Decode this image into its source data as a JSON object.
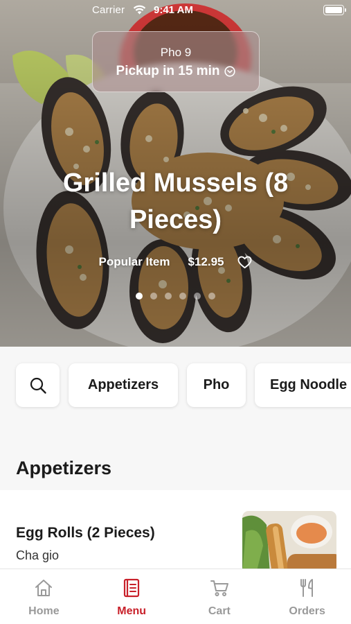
{
  "status_bar": {
    "carrier": "Carrier",
    "time": "9:41 AM"
  },
  "pickup": {
    "store": "Pho 9",
    "mode": "Pickup in 15 min",
    "icon": "chevron-down-circle-icon"
  },
  "hero": {
    "title": "Grilled Mussels (8 Pieces)",
    "tag": "Popular Item",
    "price": "$12.95",
    "favorite_icon": "heart-icon",
    "carousel": {
      "count": 6,
      "active_index": 0
    }
  },
  "categories": {
    "search_icon": "search-icon",
    "items": [
      "Appetizers",
      "Pho",
      "Egg Noodle Soup"
    ]
  },
  "section": {
    "title": "Appetizers"
  },
  "menu_items": [
    {
      "name": "Egg Rolls (2 Pieces)",
      "description": "Cha gio"
    }
  ],
  "tabs": [
    {
      "label": "Home",
      "icon": "home-icon",
      "active": false
    },
    {
      "label": "Menu",
      "icon": "menu-book-icon",
      "active": true
    },
    {
      "label": "Cart",
      "icon": "cart-icon",
      "active": false
    },
    {
      "label": "Orders",
      "icon": "fork-knife-icon",
      "active": false
    }
  ],
  "colors": {
    "accent": "#c8202a",
    "inactive_tab": "#999999",
    "background": "#f7f7f7"
  }
}
